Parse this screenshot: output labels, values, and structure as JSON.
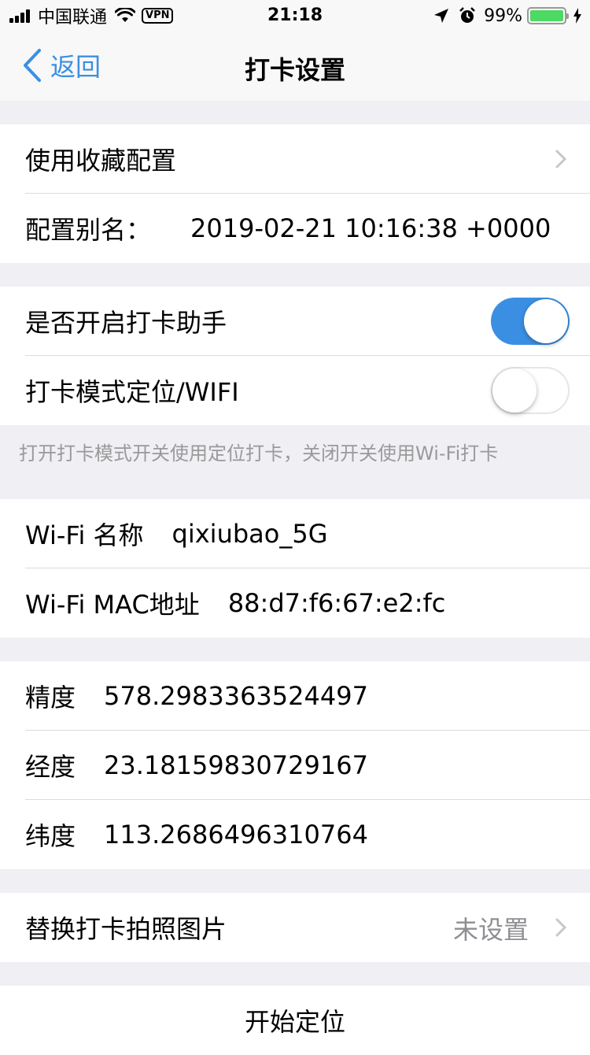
{
  "status_bar": {
    "carrier": "中国联通",
    "vpn": "VPN",
    "time": "21:18",
    "battery": "99%",
    "battery_level": 0.99,
    "icons": [
      "signal-icon",
      "wifi-icon",
      "location-arrow-icon",
      "alarm-icon",
      "battery-icon",
      "charging-icon"
    ]
  },
  "nav": {
    "back_label": "返回",
    "title": "打卡设置"
  },
  "config": {
    "use_favorite": "使用收藏配置",
    "alias_label": "配置别名：",
    "alias_value": "2019-02-21 10:16:38 +0000"
  },
  "toggles": {
    "assistant_label": "是否开启打卡助手",
    "assistant_on": true,
    "mode_label": "打卡模式定位/WIFI",
    "mode_on": false
  },
  "footnote": "打开打卡模式开关使用定位打卡，关闭开关使用Wi-Fi打卡",
  "wifi": {
    "name_label": "Wi-Fi 名称",
    "name_value": "qixiubao_5G",
    "mac_label": "Wi-Fi MAC地址",
    "mac_value": "88:d7:f6:67:e2:fc"
  },
  "location": {
    "accuracy_label": "精度",
    "accuracy_value": "578.2983363524497",
    "longitude_label": "经度",
    "longitude_value": "23.18159830729167",
    "latitude_label": "纬度",
    "latitude_value": "113.2686496310764"
  },
  "photo": {
    "label": "替换打卡拍照图片",
    "status": "未设置"
  },
  "action": {
    "start_label": "开始定位"
  },
  "colors": {
    "accent": "#3b8fe3",
    "battery": "#4cd964",
    "background": "#efeff4"
  }
}
